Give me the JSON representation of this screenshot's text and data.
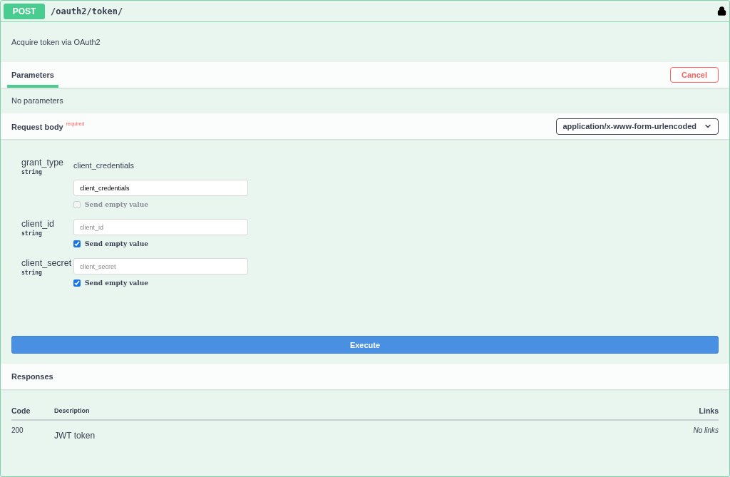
{
  "operation": {
    "method": "POST",
    "path": "/oauth2/token/"
  },
  "description": "Acquire token via OAuth2",
  "tabs": [
    {
      "label": "Parameters",
      "selected": true
    }
  ],
  "cancel_button": "Cancel",
  "parameters_note": "No parameters",
  "request_body": {
    "title": "Request body",
    "required_mark": "required",
    "content_type": "application/x-www-form-urlencoded"
  },
  "fields": [
    {
      "name": "grant_type",
      "type": "string",
      "enum_value": "client_credentials",
      "value": "client_credentials",
      "send_empty": {
        "label": "Send empty value",
        "checked": false,
        "disabled": true
      }
    },
    {
      "name": "client_id",
      "type": "string",
      "placeholder": "client_id",
      "send_empty": {
        "label": "Send empty value",
        "checked": true,
        "disabled": false
      }
    },
    {
      "name": "client_secret",
      "type": "string",
      "placeholder": "client_secret",
      "send_empty": {
        "label": "Send empty value",
        "checked": true,
        "disabled": false
      }
    }
  ],
  "execute_button": "Execute",
  "responses": {
    "title": "Responses",
    "columns": [
      "Code",
      "Description",
      "Links"
    ],
    "rows": [
      {
        "code": "200",
        "description": "JWT token",
        "links": "No links"
      }
    ]
  }
}
